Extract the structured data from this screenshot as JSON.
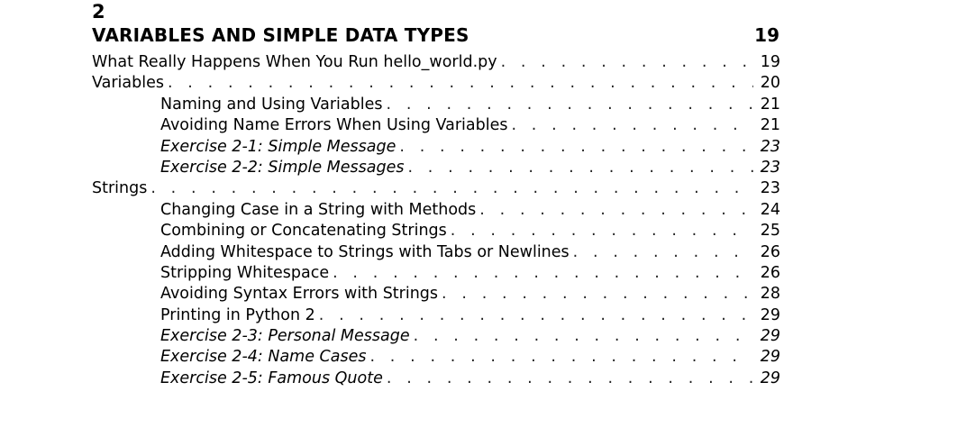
{
  "chapter": {
    "number": "2",
    "title": "VARIABLES AND SIMPLE DATA TYPES",
    "page": "19"
  },
  "entries": [
    {
      "text": "What Really Happens When You Run hello_world.py",
      "page": "19"
    },
    {
      "text": "Variables",
      "page": "20"
    },
    {
      "text": "Naming and Using Variables",
      "page": "21"
    },
    {
      "text": "Avoiding Name Errors When Using Variables",
      "page": "21"
    },
    {
      "text": "Exercise 2-1: Simple Message",
      "page": "23"
    },
    {
      "text": "Exercise 2-2: Simple Messages",
      "page": "23"
    },
    {
      "text": "Strings",
      "page": "23"
    },
    {
      "text": "Changing Case in a String with Methods",
      "page": "24"
    },
    {
      "text": "Combining or Concatenating Strings",
      "page": "25"
    },
    {
      "text": "Adding Whitespace to Strings with Tabs or Newlines",
      "page": "26"
    },
    {
      "text": "Stripping Whitespace",
      "page": "26"
    },
    {
      "text": "Avoiding Syntax Errors with Strings",
      "page": "28"
    },
    {
      "text": "Printing in Python 2",
      "page": "29"
    },
    {
      "text": "Exercise 2-3: Personal Message",
      "page": "29"
    },
    {
      "text": "Exercise 2-4: Name Cases",
      "page": "29"
    },
    {
      "text": "Exercise 2-5: Famous Quote",
      "page": "29"
    }
  ]
}
